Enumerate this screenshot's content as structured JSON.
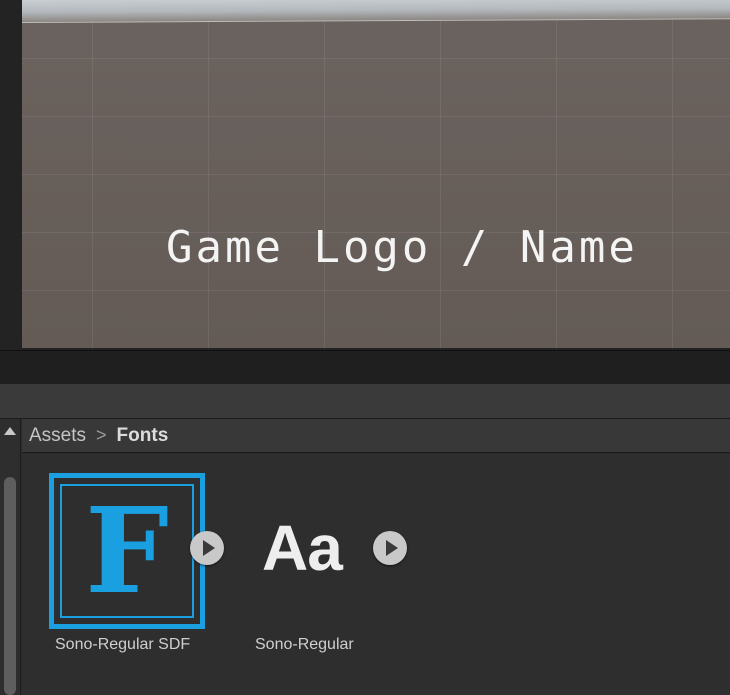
{
  "scene": {
    "title_text": "Game Logo / Name"
  },
  "breadcrumb": {
    "root": "Assets",
    "separator": ">",
    "current": "Fonts"
  },
  "assets": [
    {
      "name": "Sono-Regular SDF",
      "icon": "font-asset-sdf-icon",
      "glyph": "F",
      "accent": "#1a9fe0",
      "selected": true
    },
    {
      "name": "Sono-Regular",
      "icon": "font-file-icon",
      "glyph": "Aa",
      "selected": false
    }
  ],
  "icons": {
    "play": "play-icon",
    "scroll_up": "triangle-up-icon"
  }
}
